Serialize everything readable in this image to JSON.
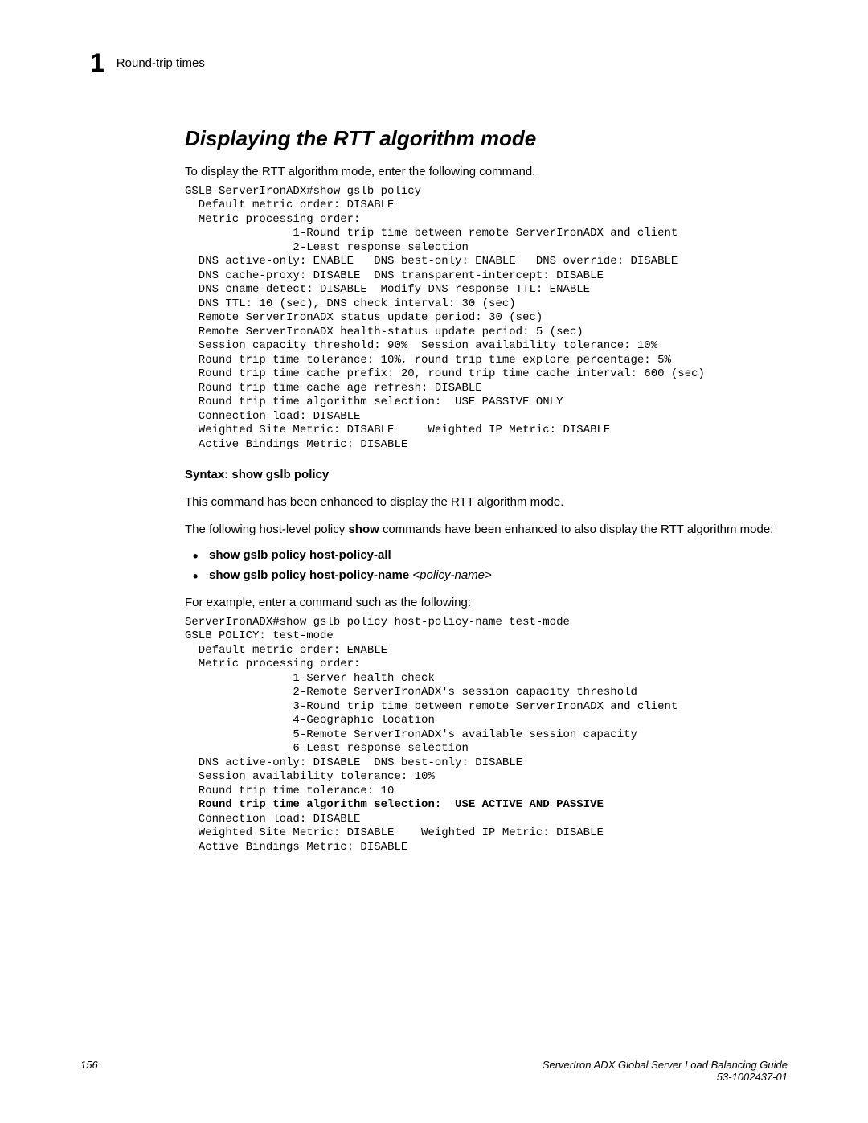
{
  "header": {
    "chapter_number": "1",
    "chapter_title": "Round-trip times"
  },
  "section": {
    "heading": "Displaying the RTT algorithm mode",
    "intro": "To display the RTT algorithm mode, enter the following command.",
    "code1": "GSLB-ServerIronADX#show gslb policy\n  Default metric order: DISABLE\n  Metric processing order:\n                1-Round trip time between remote ServerIronADX and client\n                2-Least response selection\n  DNS active-only: ENABLE   DNS best-only: ENABLE   DNS override: DISABLE\n  DNS cache-proxy: DISABLE  DNS transparent-intercept: DISABLE\n  DNS cname-detect: DISABLE  Modify DNS response TTL: ENABLE\n  DNS TTL: 10 (sec), DNS check interval: 30 (sec)\n  Remote ServerIronADX status update period: 30 (sec)\n  Remote ServerIronADX health-status update period: 5 (sec)\n  Session capacity threshold: 90%  Session availability tolerance: 10%\n  Round trip time tolerance: 10%, round trip time explore percentage: 5%\n  Round trip time cache prefix: 20, round trip time cache interval: 600 (sec)\n  Round trip time cache age refresh: DISABLE\n  Round trip time algorithm selection:  USE PASSIVE ONLY\n  Connection load: DISABLE\n  Weighted Site Metric: DISABLE     Weighted IP Metric: DISABLE\n  Active Bindings Metric: DISABLE",
    "syntax_label": "Syntax: ",
    "syntax_value": "show gslb policy",
    "desc1": "This command has been enhanced to display the RTT algorithm mode.",
    "desc2_a": "The following host-level policy ",
    "desc2_b": "show",
    "desc2_c": " commands have been enhanced to also display the RTT algorithm mode:",
    "bullets": [
      {
        "bold": "show gslb policy host-policy-all",
        "italic": ""
      },
      {
        "bold": "show gslb policy host-policy-name ",
        "italic": "<policy-name>"
      }
    ],
    "desc3": "For example, enter a command such as the following:",
    "code2_pre": "ServerIronADX#show gslb policy host-policy-name test-mode\nGSLB POLICY: test-mode\n  Default metric order: ENABLE\n  Metric processing order:\n                1-Server health check\n                2-Remote ServerIronADX's session capacity threshold\n                3-Round trip time between remote ServerIronADX and client\n                4-Geographic location\n                5-Remote ServerIronADX's available session capacity\n                6-Least response selection\n  DNS active-only: DISABLE  DNS best-only: DISABLE\n  Session availability tolerance: 10%\n  Round trip time tolerance: 10",
    "code2_highlight": "  Round trip time algorithm selection:  USE ACTIVE AND PASSIVE",
    "code2_post": "  Connection load: DISABLE\n  Weighted Site Metric: DISABLE    Weighted IP Metric: DISABLE\n  Active Bindings Metric: DISABLE"
  },
  "footer": {
    "page_number": "156",
    "doc_title": "ServerIron ADX Global Server Load Balancing Guide",
    "doc_id": "53-1002437-01"
  }
}
